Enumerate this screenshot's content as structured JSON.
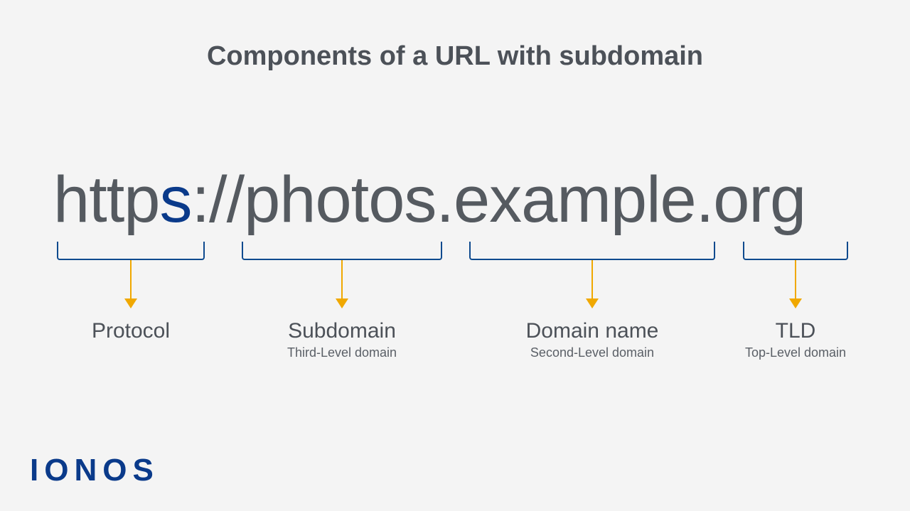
{
  "title": "Components of a URL with subdomain",
  "url": {
    "part1": "http",
    "part_s": "s",
    "part1b": "://",
    "part2": "photos",
    "dot1": ".",
    "part3": "example",
    "dot2": ".",
    "part4": "org"
  },
  "segments": {
    "protocol": {
      "label": "Protocol",
      "sublabel": ""
    },
    "subdomain": {
      "label": "Subdomain",
      "sublabel": "Third-Level domain"
    },
    "domain": {
      "label": "Domain name",
      "sublabel": "Second-Level domain"
    },
    "tld": {
      "label": "TLD",
      "sublabel": "Top-Level domain"
    }
  },
  "logo": "IONOS",
  "colors": {
    "bracket": "#0e4a8e",
    "arrow": "#f0a800",
    "text": "#4c5158",
    "logo": "#0a3a8a"
  }
}
